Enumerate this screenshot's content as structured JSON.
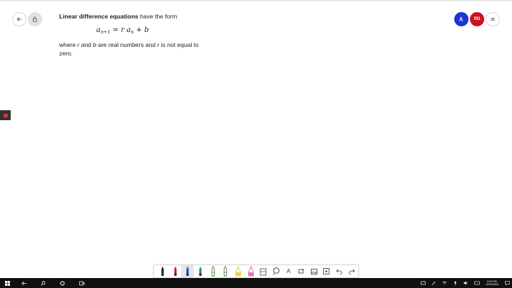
{
  "header": {
    "avatars": [
      {
        "initials": "",
        "color": "#1b35d8",
        "icon": "person-icon"
      },
      {
        "initials": "RD",
        "color": "#cf1020"
      }
    ]
  },
  "content": {
    "title_bold": "Linear difference equations",
    "title_rest": " have the form",
    "formula": {
      "lhs_base": "a",
      "lhs_sub": "n+1",
      "eq": " = r ",
      "rhs_base": "a",
      "rhs_sub": "n",
      "rest": " + b"
    },
    "desc_1": "where ",
    "var_r": "r",
    "desc_2": " and ",
    "var_b": "b",
    "desc_3": " are real numbers and ",
    "desc_4": " is not equal to zero."
  },
  "toolbar": {
    "tools": [
      {
        "name": "pen-black-tool",
        "color": "#222222"
      },
      {
        "name": "pen-red-tool",
        "color": "#d02020"
      },
      {
        "name": "pen-blue-tool",
        "color": "#1b4fd8"
      },
      {
        "name": "pen-green-tool",
        "color": "#2a9a3a"
      },
      {
        "name": "pencil-green-tool",
        "color": "#3d8a2a"
      },
      {
        "name": "pencil-outline-tool",
        "color": "#666666"
      },
      {
        "name": "highlighter-yellow-tool",
        "color": "#e0d23a"
      },
      {
        "name": "highlighter-pink-tool",
        "color": "#e070b0"
      },
      {
        "name": "eraser-tool",
        "color": "#555555"
      },
      {
        "name": "lasso-tool",
        "color": "#333333"
      },
      {
        "name": "text-tool",
        "color": "#333333",
        "glyph": "A"
      },
      {
        "name": "shapes-tool",
        "color": "#333333"
      },
      {
        "name": "image-tool",
        "color": "#333333"
      },
      {
        "name": "add-page-tool",
        "color": "#333333"
      },
      {
        "name": "undo-tool",
        "color": "#333333"
      },
      {
        "name": "redo-tool",
        "color": "#333333"
      }
    ]
  },
  "taskbar": {
    "time": "5:22 PM",
    "date": "10/12/2020"
  }
}
